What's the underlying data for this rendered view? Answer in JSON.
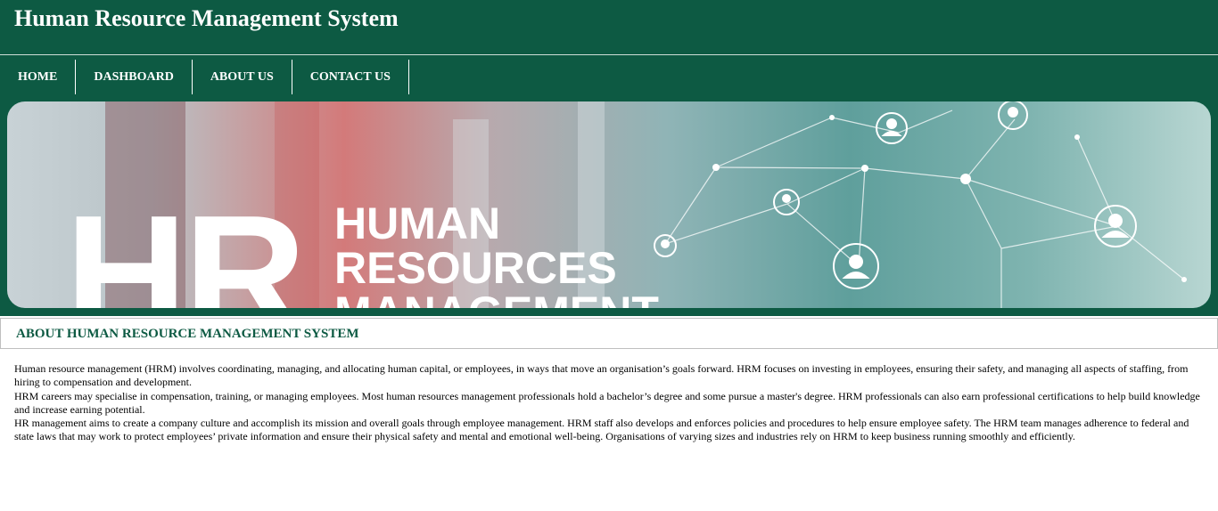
{
  "header": {
    "title": "Human Resource Management System"
  },
  "nav": {
    "items": [
      {
        "label": "HOME"
      },
      {
        "label": "DASHBOARD"
      },
      {
        "label": "ABOUT US"
      },
      {
        "label": "CONTACT US"
      }
    ]
  },
  "banner": {
    "big_text": "HR",
    "lines": [
      "HUMAN",
      "RESOURCES",
      "MANAGEMENT"
    ]
  },
  "about": {
    "heading": "ABOUT HUMAN RESOURCE MANAGEMENT SYSTEM",
    "paragraphs": [
      "Human resource management (HRM) involves coordinating, managing, and allocating human capital, or employees, in ways that move an organisation’s goals forward. HRM focuses on investing in employees, ensuring their safety, and managing all aspects of staffing, from hiring to compensation and development.",
      "HRM careers may specialise in compensation, training, or managing employees. Most human resources management professionals hold a bachelor’s degree and some pursue a master's degree. HRM professionals can also earn professional certifications to help build knowledge and increase earning potential.",
      "HR management aims to create a company culture and accomplish its mission and overall goals through employee management. HRM staff also develops and enforces policies and procedures to help ensure employee safety. The HRM team manages adherence to federal and state laws that may work to protect employees’ private information and ensure their physical safety and mental and emotional well-being. Organisations of varying sizes and industries rely on HRM to keep business running smoothly and efficiently."
    ]
  },
  "colors": {
    "header_bg": "#0d5a43",
    "heading_text": "#0d5a43"
  }
}
